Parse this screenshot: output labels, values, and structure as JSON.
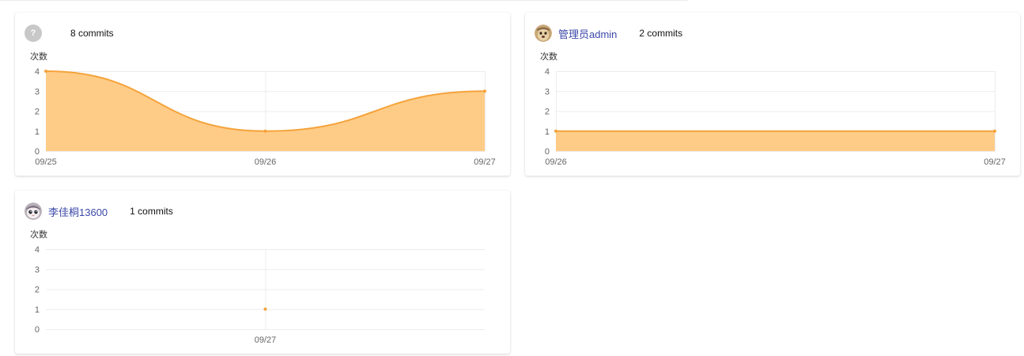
{
  "colors": {
    "series_line": "#f5a33a",
    "series_fill": "#ffcc88",
    "grid": "#ececec",
    "axis_text": "#666666",
    "link": "#3a48a8"
  },
  "cards": [
    {
      "user": {
        "name": "",
        "avatar": "question-mark",
        "avatar_text": "?"
      },
      "commits_label": "8 commits",
      "chart_data": {
        "type": "area",
        "ylabel": "次数",
        "categories": [
          "09/25",
          "09/26",
          "09/27"
        ],
        "values": [
          4,
          1,
          3
        ],
        "yticks": [
          "0",
          "1",
          "2",
          "3",
          "4"
        ],
        "ylim": [
          0,
          4
        ],
        "smooth": true,
        "grid": true
      }
    },
    {
      "user": {
        "name": "管理员admin",
        "avatar": "photo"
      },
      "commits_label": "2 commits",
      "chart_data": {
        "type": "area",
        "ylabel": "次数",
        "categories": [
          "09/26",
          "09/27"
        ],
        "values": [
          1,
          1
        ],
        "yticks": [
          "0",
          "1",
          "2",
          "3",
          "4"
        ],
        "ylim": [
          0,
          4
        ],
        "smooth": false,
        "grid": true
      }
    },
    {
      "user": {
        "name": "李佳桐13600",
        "avatar": "cartoon"
      },
      "commits_label": "1 commits",
      "chart_data": {
        "type": "area",
        "ylabel": "次数",
        "categories": [
          "09/27"
        ],
        "values": [
          1
        ],
        "yticks": [
          "0",
          "1",
          "2",
          "3",
          "4"
        ],
        "ylim": [
          0,
          4
        ],
        "smooth": false,
        "grid": true
      }
    }
  ]
}
